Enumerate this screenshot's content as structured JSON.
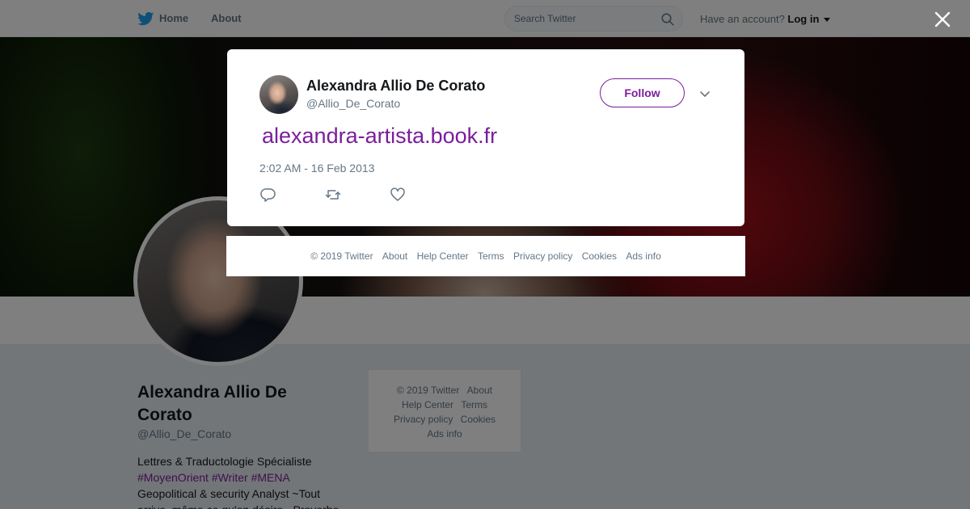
{
  "nav": {
    "home_label": "Home",
    "about_label": "About",
    "search_placeholder": "Search Twitter",
    "account_prompt": "Have an account?",
    "login_label": "Log in",
    "icons": {
      "logo": "twitter-bird-icon",
      "search": "search-icon",
      "caret": "caret-down-icon"
    }
  },
  "profile": {
    "name": "Alexandra Allio De Corato",
    "handle": "@Allio_De_Corato",
    "bio_line1": "Lettres & Traductologie Spécialiste",
    "hashtags": [
      "#MoyenOrient",
      "#Writer",
      "#MENA"
    ],
    "bio_line3": "Geopolitical & security Analyst ~Tout",
    "bio_line4": "arrive, même ce qu'on désire.- Proverbe"
  },
  "page_footer": {
    "copyright": "© 2019 Twitter",
    "about": "About",
    "help_center": "Help Center",
    "terms": "Terms",
    "privacy": "Privacy policy",
    "cookies": "Cookies",
    "ads_info": "Ads info"
  },
  "tweet": {
    "author_name": "Alexandra Allio De Corato",
    "author_handle": "@Allio_De_Corato",
    "follow_label": "Follow",
    "text": "alexandra-artista.book.fr",
    "timestamp": "2:02 AM - 16 Feb 2013",
    "icons": {
      "reply": "reply-icon",
      "retweet": "retweet-icon",
      "like": "heart-icon",
      "more": "chevron-down-icon",
      "close": "close-icon"
    }
  },
  "modal_footer": {
    "copyright": "© 2019 Twitter",
    "about": "About",
    "help_center": "Help Center",
    "terms": "Terms",
    "privacy": "Privacy policy",
    "cookies": "Cookies",
    "ads_info": "Ads info"
  },
  "colors": {
    "accent": "#7a1e9c",
    "twitter_blue": "#1da1f2",
    "text_primary": "#14171a",
    "text_secondary": "#657786",
    "background": "#e6ecf0"
  }
}
